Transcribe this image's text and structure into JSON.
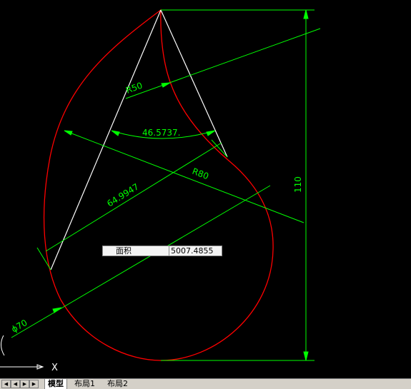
{
  "drawing": {
    "dimensions": {
      "radius_small": "R50",
      "angle": "46.5737.",
      "radius_large": "R80",
      "aligned_length": "64.9947",
      "height": "110",
      "diameter": "ϕ70"
    },
    "area_query": {
      "label": "面积",
      "value": "5007.4855"
    }
  },
  "ucs": {
    "x_label": "X"
  },
  "tabs": {
    "model": "模型",
    "layout1": "布局1",
    "layout2": "布局2"
  },
  "icons": {
    "first": "first-tab-icon",
    "prev": "prev-tab-icon",
    "next": "next-tab-icon",
    "last": "last-tab-icon"
  },
  "colors": {
    "background": "#000000",
    "outline": "#ff0000",
    "dimension": "#00ff00",
    "construction": "#ffffff"
  }
}
